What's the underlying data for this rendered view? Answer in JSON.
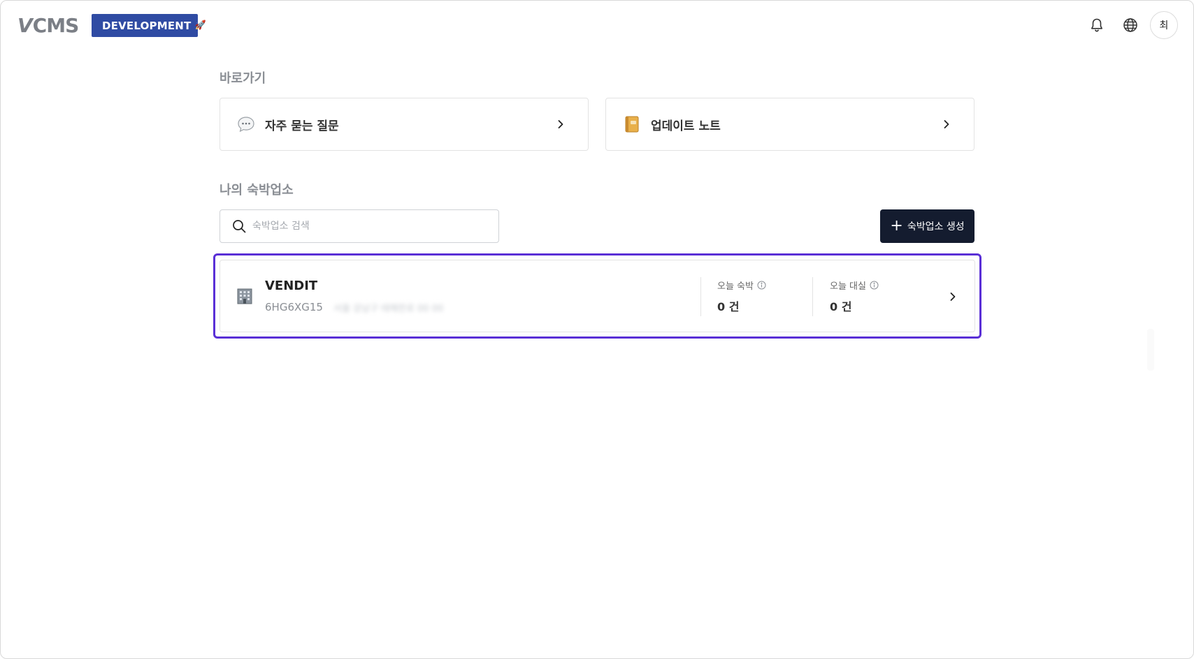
{
  "header": {
    "logo_text": "CMS",
    "logo_mark": "V",
    "environment_badge": "DEVELOPMENT",
    "environment_emoji": "🚀",
    "avatar_initial": "최",
    "icons": [
      "bell-icon",
      "globe-icon"
    ]
  },
  "shortcuts": {
    "title": "바로가기",
    "items": [
      {
        "icon": "speech-bubble-icon",
        "label": "자주 묻는 질문"
      },
      {
        "icon": "notebook-icon",
        "label": "업데이트 노트"
      }
    ]
  },
  "my_properties": {
    "title": "나의 숙박업소",
    "search_placeholder": "숙박업소 검색",
    "create_button_label": "숙박업소 생성",
    "list": [
      {
        "icon": "building-icon",
        "name": "VENDIT",
        "code": "6HG6XG15",
        "address_blurred": "서울 강남구 테헤란로 00 00",
        "stats": [
          {
            "label": "오늘 숙박",
            "value": "0 건"
          },
          {
            "label": "오늘 대실",
            "value": "0 건"
          }
        ]
      }
    ]
  },
  "colors": {
    "badge_bg": "#2f4ba3",
    "primary_button_bg": "#141c2f",
    "selection_outline": "#5a2fd6"
  }
}
